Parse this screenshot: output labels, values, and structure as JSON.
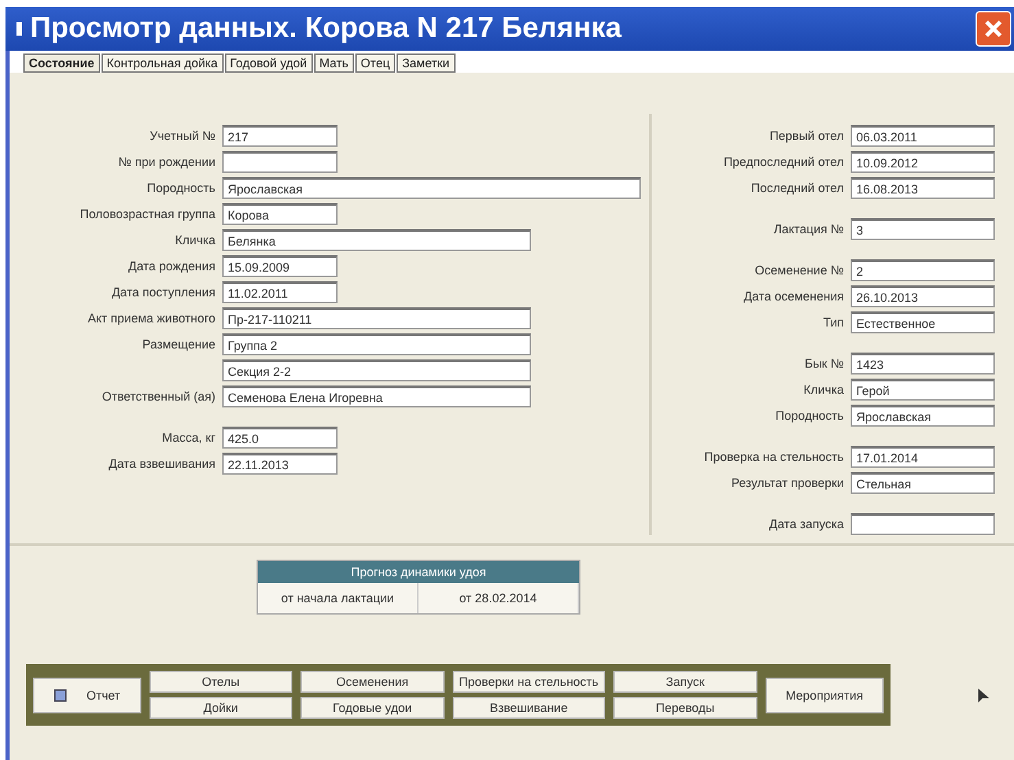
{
  "window": {
    "title": "Просмотр данных. Корова N 217  Белянка"
  },
  "tabs": [
    {
      "label": "Состояние",
      "selected": true
    },
    {
      "label": "Контрольная дойка",
      "selected": false
    },
    {
      "label": "Годовой удой",
      "selected": false
    },
    {
      "label": "Мать",
      "selected": false
    },
    {
      "label": "Отец",
      "selected": false
    },
    {
      "label": "Заметки",
      "selected": false
    }
  ],
  "left_fields": [
    {
      "label": "Учетный №",
      "value": "217",
      "kind": "short"
    },
    {
      "label": "№ при рождении",
      "kind": "short"
    },
    {
      "label": "Породность",
      "value": "Ярославская",
      "kind": "long"
    },
    {
      "label": "Половозрастная группа",
      "value": "Корова",
      "kind": "short"
    },
    {
      "label": "Кличка",
      "value": "Белянка",
      "kind": "medium"
    },
    {
      "label": "Дата рождения",
      "value": "15.09.2009",
      "kind": "short"
    },
    {
      "label": "Дата поступления",
      "value": "11.02.2011",
      "kind": "short"
    },
    {
      "label": "Акт приема животного",
      "value": "Пр-217-110211",
      "kind": "medium"
    },
    {
      "label": "Размещение",
      "value": "Группа 2",
      "kind": "medium"
    },
    {
      "value": "Секция 2-2",
      "kind": "medium"
    },
    {
      "label": "Ответственный (ая)",
      "value": "Семенова Елена Игоревна",
      "kind": "medium"
    },
    {
      "label": "Масса, кг",
      "value": "425.0",
      "kind": "short",
      "gap_before": true
    },
    {
      "label": "Дата взвешивания",
      "value": "22.11.2013",
      "kind": "short"
    }
  ],
  "right_fields": [
    {
      "label": "Первый отел",
      "value": "06.03.2011"
    },
    {
      "label": "Предпоследний отел",
      "value": "10.09.2012"
    },
    {
      "label": "Последний отел",
      "value": "16.08.2013"
    },
    {
      "label": "Лактация №",
      "value": "3",
      "gap_before": true
    },
    {
      "label": "Осеменение №",
      "value": "2",
      "gap_before": true
    },
    {
      "label": "Дата осеменения",
      "value": "26.10.2013"
    },
    {
      "label": "Тип",
      "value": "Естественное"
    },
    {
      "label": "Бык №",
      "value": "1423",
      "gap_before": true
    },
    {
      "label": "Кличка",
      "value": "Герой"
    },
    {
      "label": "Породность",
      "value": "Ярославская"
    },
    {
      "label": "Проверка на стельность",
      "value": "17.01.2014",
      "gap_before": true
    },
    {
      "label": "Результат проверки",
      "value": "Стельная"
    },
    {
      "label": "Дата запуска",
      "gap_before": true
    }
  ],
  "forecast": {
    "title": "Прогноз динамики удоя",
    "cells": [
      "от начала лактации",
      "от 28.02.2014"
    ]
  },
  "report_button": "Отчет",
  "buttons": [
    [
      "Отелы",
      "Дойки"
    ],
    [
      "Осеменения",
      "Годовые удои"
    ],
    [
      "Проверки на стельность",
      "Взвешивание"
    ],
    [
      "Запуск",
      "Переводы"
    ]
  ],
  "events_button": "Мероприятия"
}
